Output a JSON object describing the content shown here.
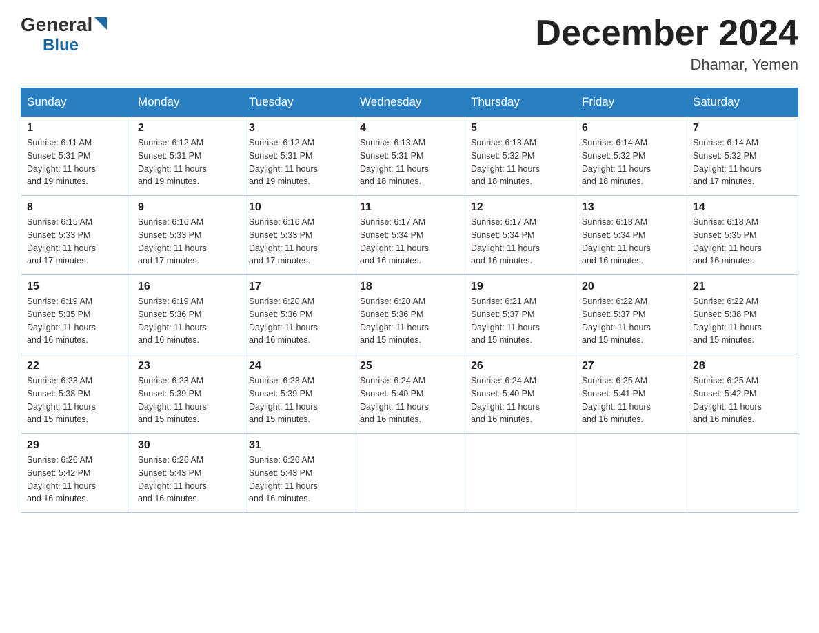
{
  "logo": {
    "general": "General",
    "blue": "Blue"
  },
  "title": {
    "month_year": "December 2024",
    "location": "Dhamar, Yemen"
  },
  "weekdays": [
    "Sunday",
    "Monday",
    "Tuesday",
    "Wednesday",
    "Thursday",
    "Friday",
    "Saturday"
  ],
  "weeks": [
    [
      {
        "day": "1",
        "sunrise": "6:11 AM",
        "sunset": "5:31 PM",
        "daylight": "11 hours and 19 minutes."
      },
      {
        "day": "2",
        "sunrise": "6:12 AM",
        "sunset": "5:31 PM",
        "daylight": "11 hours and 19 minutes."
      },
      {
        "day": "3",
        "sunrise": "6:12 AM",
        "sunset": "5:31 PM",
        "daylight": "11 hours and 19 minutes."
      },
      {
        "day": "4",
        "sunrise": "6:13 AM",
        "sunset": "5:31 PM",
        "daylight": "11 hours and 18 minutes."
      },
      {
        "day": "5",
        "sunrise": "6:13 AM",
        "sunset": "5:32 PM",
        "daylight": "11 hours and 18 minutes."
      },
      {
        "day": "6",
        "sunrise": "6:14 AM",
        "sunset": "5:32 PM",
        "daylight": "11 hours and 18 minutes."
      },
      {
        "day": "7",
        "sunrise": "6:14 AM",
        "sunset": "5:32 PM",
        "daylight": "11 hours and 17 minutes."
      }
    ],
    [
      {
        "day": "8",
        "sunrise": "6:15 AM",
        "sunset": "5:33 PM",
        "daylight": "11 hours and 17 minutes."
      },
      {
        "day": "9",
        "sunrise": "6:16 AM",
        "sunset": "5:33 PM",
        "daylight": "11 hours and 17 minutes."
      },
      {
        "day": "10",
        "sunrise": "6:16 AM",
        "sunset": "5:33 PM",
        "daylight": "11 hours and 17 minutes."
      },
      {
        "day": "11",
        "sunrise": "6:17 AM",
        "sunset": "5:34 PM",
        "daylight": "11 hours and 16 minutes."
      },
      {
        "day": "12",
        "sunrise": "6:17 AM",
        "sunset": "5:34 PM",
        "daylight": "11 hours and 16 minutes."
      },
      {
        "day": "13",
        "sunrise": "6:18 AM",
        "sunset": "5:34 PM",
        "daylight": "11 hours and 16 minutes."
      },
      {
        "day": "14",
        "sunrise": "6:18 AM",
        "sunset": "5:35 PM",
        "daylight": "11 hours and 16 minutes."
      }
    ],
    [
      {
        "day": "15",
        "sunrise": "6:19 AM",
        "sunset": "5:35 PM",
        "daylight": "11 hours and 16 minutes."
      },
      {
        "day": "16",
        "sunrise": "6:19 AM",
        "sunset": "5:36 PM",
        "daylight": "11 hours and 16 minutes."
      },
      {
        "day": "17",
        "sunrise": "6:20 AM",
        "sunset": "5:36 PM",
        "daylight": "11 hours and 16 minutes."
      },
      {
        "day": "18",
        "sunrise": "6:20 AM",
        "sunset": "5:36 PM",
        "daylight": "11 hours and 15 minutes."
      },
      {
        "day": "19",
        "sunrise": "6:21 AM",
        "sunset": "5:37 PM",
        "daylight": "11 hours and 15 minutes."
      },
      {
        "day": "20",
        "sunrise": "6:22 AM",
        "sunset": "5:37 PM",
        "daylight": "11 hours and 15 minutes."
      },
      {
        "day": "21",
        "sunrise": "6:22 AM",
        "sunset": "5:38 PM",
        "daylight": "11 hours and 15 minutes."
      }
    ],
    [
      {
        "day": "22",
        "sunrise": "6:23 AM",
        "sunset": "5:38 PM",
        "daylight": "11 hours and 15 minutes."
      },
      {
        "day": "23",
        "sunrise": "6:23 AM",
        "sunset": "5:39 PM",
        "daylight": "11 hours and 15 minutes."
      },
      {
        "day": "24",
        "sunrise": "6:23 AM",
        "sunset": "5:39 PM",
        "daylight": "11 hours and 15 minutes."
      },
      {
        "day": "25",
        "sunrise": "6:24 AM",
        "sunset": "5:40 PM",
        "daylight": "11 hours and 16 minutes."
      },
      {
        "day": "26",
        "sunrise": "6:24 AM",
        "sunset": "5:40 PM",
        "daylight": "11 hours and 16 minutes."
      },
      {
        "day": "27",
        "sunrise": "6:25 AM",
        "sunset": "5:41 PM",
        "daylight": "11 hours and 16 minutes."
      },
      {
        "day": "28",
        "sunrise": "6:25 AM",
        "sunset": "5:42 PM",
        "daylight": "11 hours and 16 minutes."
      }
    ],
    [
      {
        "day": "29",
        "sunrise": "6:26 AM",
        "sunset": "5:42 PM",
        "daylight": "11 hours and 16 minutes."
      },
      {
        "day": "30",
        "sunrise": "6:26 AM",
        "sunset": "5:43 PM",
        "daylight": "11 hours and 16 minutes."
      },
      {
        "day": "31",
        "sunrise": "6:26 AM",
        "sunset": "5:43 PM",
        "daylight": "11 hours and 16 minutes."
      },
      null,
      null,
      null,
      null
    ]
  ],
  "labels": {
    "sunrise": "Sunrise:",
    "sunset": "Sunset:",
    "daylight": "Daylight:"
  }
}
